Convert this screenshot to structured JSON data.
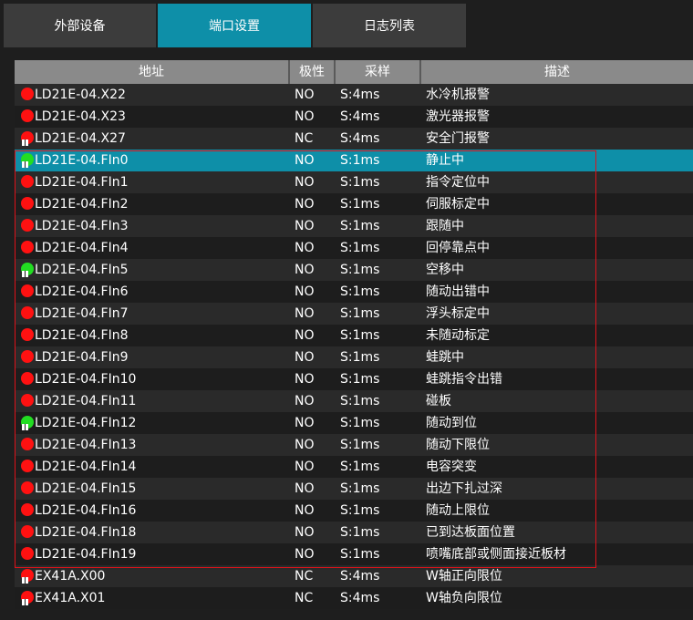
{
  "tabs": [
    {
      "label": "外部设备",
      "active": false
    },
    {
      "label": "端口设置",
      "active": true
    },
    {
      "label": "日志列表",
      "active": false
    }
  ],
  "table": {
    "columns": [
      "地址",
      "极性",
      "采样",
      "描述"
    ],
    "rows": [
      {
        "address": "LD21E-04.X22",
        "polarity": "NO",
        "sampling": "S:4ms",
        "description": "水冷机报警",
        "status": "red",
        "pin": false
      },
      {
        "address": "LD21E-04.X23",
        "polarity": "NO",
        "sampling": "S:4ms",
        "description": "激光器报警",
        "status": "red",
        "pin": false
      },
      {
        "address": "LD21E-04.X27",
        "polarity": "NC",
        "sampling": "S:4ms",
        "description": "安全门报警",
        "status": "red",
        "pin": true
      },
      {
        "address": "LD21E-04.FIn0",
        "polarity": "NO",
        "sampling": "S:1ms",
        "description": "静止中",
        "status": "green",
        "pin": true,
        "selected": true
      },
      {
        "address": "LD21E-04.FIn1",
        "polarity": "NO",
        "sampling": "S:1ms",
        "description": "指令定位中",
        "status": "red",
        "pin": false
      },
      {
        "address": "LD21E-04.FIn2",
        "polarity": "NO",
        "sampling": "S:1ms",
        "description": "伺服标定中",
        "status": "red",
        "pin": false
      },
      {
        "address": "LD21E-04.FIn3",
        "polarity": "NO",
        "sampling": "S:1ms",
        "description": "跟随中",
        "status": "red",
        "pin": false
      },
      {
        "address": "LD21E-04.FIn4",
        "polarity": "NO",
        "sampling": "S:1ms",
        "description": "回停靠点中",
        "status": "red",
        "pin": false
      },
      {
        "address": "LD21E-04.FIn5",
        "polarity": "NO",
        "sampling": "S:1ms",
        "description": "空移中",
        "status": "green",
        "pin": true
      },
      {
        "address": "LD21E-04.FIn6",
        "polarity": "NO",
        "sampling": "S:1ms",
        "description": "随动出错中",
        "status": "red",
        "pin": false
      },
      {
        "address": "LD21E-04.FIn7",
        "polarity": "NO",
        "sampling": "S:1ms",
        "description": "浮头标定中",
        "status": "red",
        "pin": false
      },
      {
        "address": "LD21E-04.FIn8",
        "polarity": "NO",
        "sampling": "S:1ms",
        "description": "未随动标定",
        "status": "red",
        "pin": false
      },
      {
        "address": "LD21E-04.FIn9",
        "polarity": "NO",
        "sampling": "S:1ms",
        "description": "蛙跳中",
        "status": "red",
        "pin": false
      },
      {
        "address": "LD21E-04.FIn10",
        "polarity": "NO",
        "sampling": "S:1ms",
        "description": "蛙跳指令出错",
        "status": "red",
        "pin": false
      },
      {
        "address": "LD21E-04.FIn11",
        "polarity": "NO",
        "sampling": "S:1ms",
        "description": "碰板",
        "status": "red",
        "pin": false
      },
      {
        "address": "LD21E-04.FIn12",
        "polarity": "NO",
        "sampling": "S:1ms",
        "description": "随动到位",
        "status": "green",
        "pin": true
      },
      {
        "address": "LD21E-04.FIn13",
        "polarity": "NO",
        "sampling": "S:1ms",
        "description": "随动下限位",
        "status": "red",
        "pin": false
      },
      {
        "address": "LD21E-04.FIn14",
        "polarity": "NO",
        "sampling": "S:1ms",
        "description": "电容突变",
        "status": "red",
        "pin": false
      },
      {
        "address": "LD21E-04.FIn15",
        "polarity": "NO",
        "sampling": "S:1ms",
        "description": "出边下扎过深",
        "status": "red",
        "pin": false
      },
      {
        "address": "LD21E-04.FIn16",
        "polarity": "NO",
        "sampling": "S:1ms",
        "description": "随动上限位",
        "status": "red",
        "pin": false
      },
      {
        "address": "LD21E-04.FIn18",
        "polarity": "NO",
        "sampling": "S:1ms",
        "description": "已到达板面位置",
        "status": "red",
        "pin": false
      },
      {
        "address": "LD21E-04.FIn19",
        "polarity": "NO",
        "sampling": "S:1ms",
        "description": "喷嘴底部或侧面接近板材",
        "status": "red",
        "pin": false
      },
      {
        "address": "EX41A.X00",
        "polarity": "NC",
        "sampling": "S:4ms",
        "description": "W轴正向限位",
        "status": "red",
        "pin": true
      },
      {
        "address": "EX41A.X01",
        "polarity": "NC",
        "sampling": "S:4ms",
        "description": "W轴负向限位",
        "status": "red",
        "pin": true
      }
    ]
  },
  "colors": {
    "accent": "#0e8fa8",
    "header_bg": "#8a8a8a",
    "status_red": "#ff1111",
    "status_green": "#22dd22",
    "highlight_border": "#e0121a"
  }
}
